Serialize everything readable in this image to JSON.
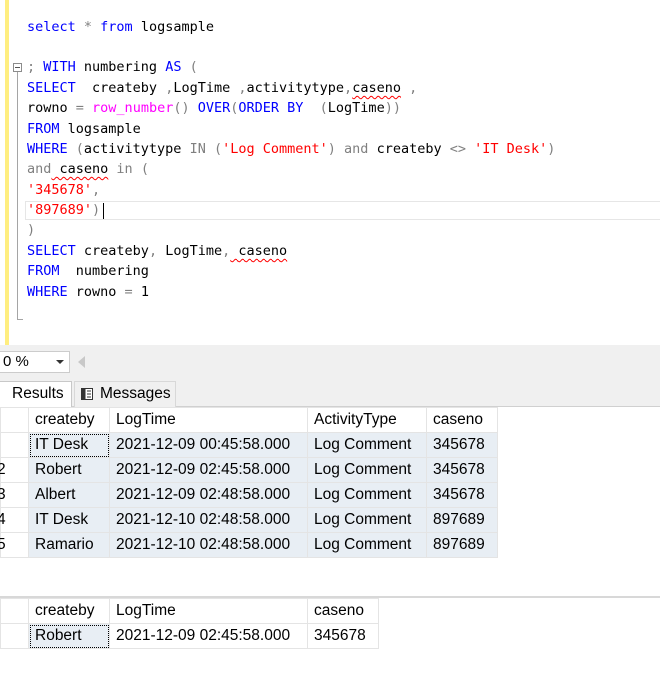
{
  "editor": {
    "lines": {
      "l1": {
        "kw1": "select",
        "op1": " * ",
        "kw2": "from",
        "t1": " logsample"
      },
      "l2": {
        "op1": ";",
        "kw1": " WITH",
        "t1": " numbering ",
        "kw2": "AS",
        "op2": " ("
      },
      "l3": {
        "kw1": "SELECT",
        "t1": "  createby ",
        "op1": ",",
        "t2": "LogTime ",
        "op2": ",",
        "t3": "activitytype",
        "op3": ",",
        "sq1": "caseno",
        "op4": " ,"
      },
      "l4": {
        "t1": "rowno ",
        "op1": "=",
        "fn1": " row_number",
        "op2": "()",
        "kw1": " OVER",
        "op3": "(",
        "kw2": "ORDER BY",
        "op4": "  (",
        "t2": "LogTime",
        "op5": "))"
      },
      "l5": {
        "kw1": "FROM",
        "t1": " logsample"
      },
      "l6": {
        "kw1": "WHERE",
        "op1": " (",
        "t1": "activitytype ",
        "op2": "IN",
        "op3": " (",
        "str1": "'Log Comment'",
        "op4": ")",
        "op5": " and",
        "t2": " createby ",
        "op6": "<>",
        "str2": " 'IT Desk'",
        "op7": ")"
      },
      "l7": {
        "op1": "and",
        "sq1": " caseno",
        "op2": " in",
        "op3": " ("
      },
      "l8": {
        "str1": "'345678'",
        "op1": ","
      },
      "l9": {
        "str1": "'897689'",
        "op1": ")"
      },
      "l10": {
        "op1": ")"
      },
      "l11": {
        "kw1": "SELECT",
        "t1": " createby",
        "op1": ",",
        "t2": " LogTime",
        "op2": ",",
        "sq1": " caseno"
      },
      "l12": {
        "kw1": "FROM",
        "t1": "  numbering"
      },
      "l13": {
        "kw1": "WHERE",
        "t1": " rowno ",
        "op1": "=",
        "t2": " 1"
      }
    }
  },
  "zoom": {
    "value": "0 %"
  },
  "tabs": {
    "results": "Results",
    "messages": "Messages"
  },
  "results1": {
    "columns": [
      "createby",
      "LogTime",
      "ActivityType",
      "caseno"
    ],
    "row_numbers": [
      "",
      "2",
      "3",
      "4",
      "5"
    ],
    "rows": [
      [
        "IT Desk",
        "2021-12-09 00:45:58.000",
        "Log Comment",
        "345678"
      ],
      [
        "Robert",
        "2021-12-09 02:45:58.000",
        "Log Comment",
        "345678"
      ],
      [
        "Albert",
        "2021-12-09 02:48:58.000",
        "Log Comment",
        "345678"
      ],
      [
        "IT Desk",
        "2021-12-10 02:48:58.000",
        "Log Comment",
        "897689"
      ],
      [
        "Ramario",
        "2021-12-10 02:48:58.000",
        "Log Comment",
        "897689"
      ]
    ]
  },
  "results2": {
    "columns": [
      "createby",
      "LogTime",
      "caseno"
    ],
    "rows": [
      [
        "Robert",
        "2021-12-09 02:45:58.000",
        "345678"
      ]
    ]
  },
  "colors": {
    "keyword": "#0000ff",
    "string": "#ff0000",
    "function": "#ff00ff",
    "operator": "#808080",
    "cell_bg": "#e8eef4"
  },
  "icons": {
    "collapse": "minus-box-icon",
    "messages": "messages-icon"
  }
}
